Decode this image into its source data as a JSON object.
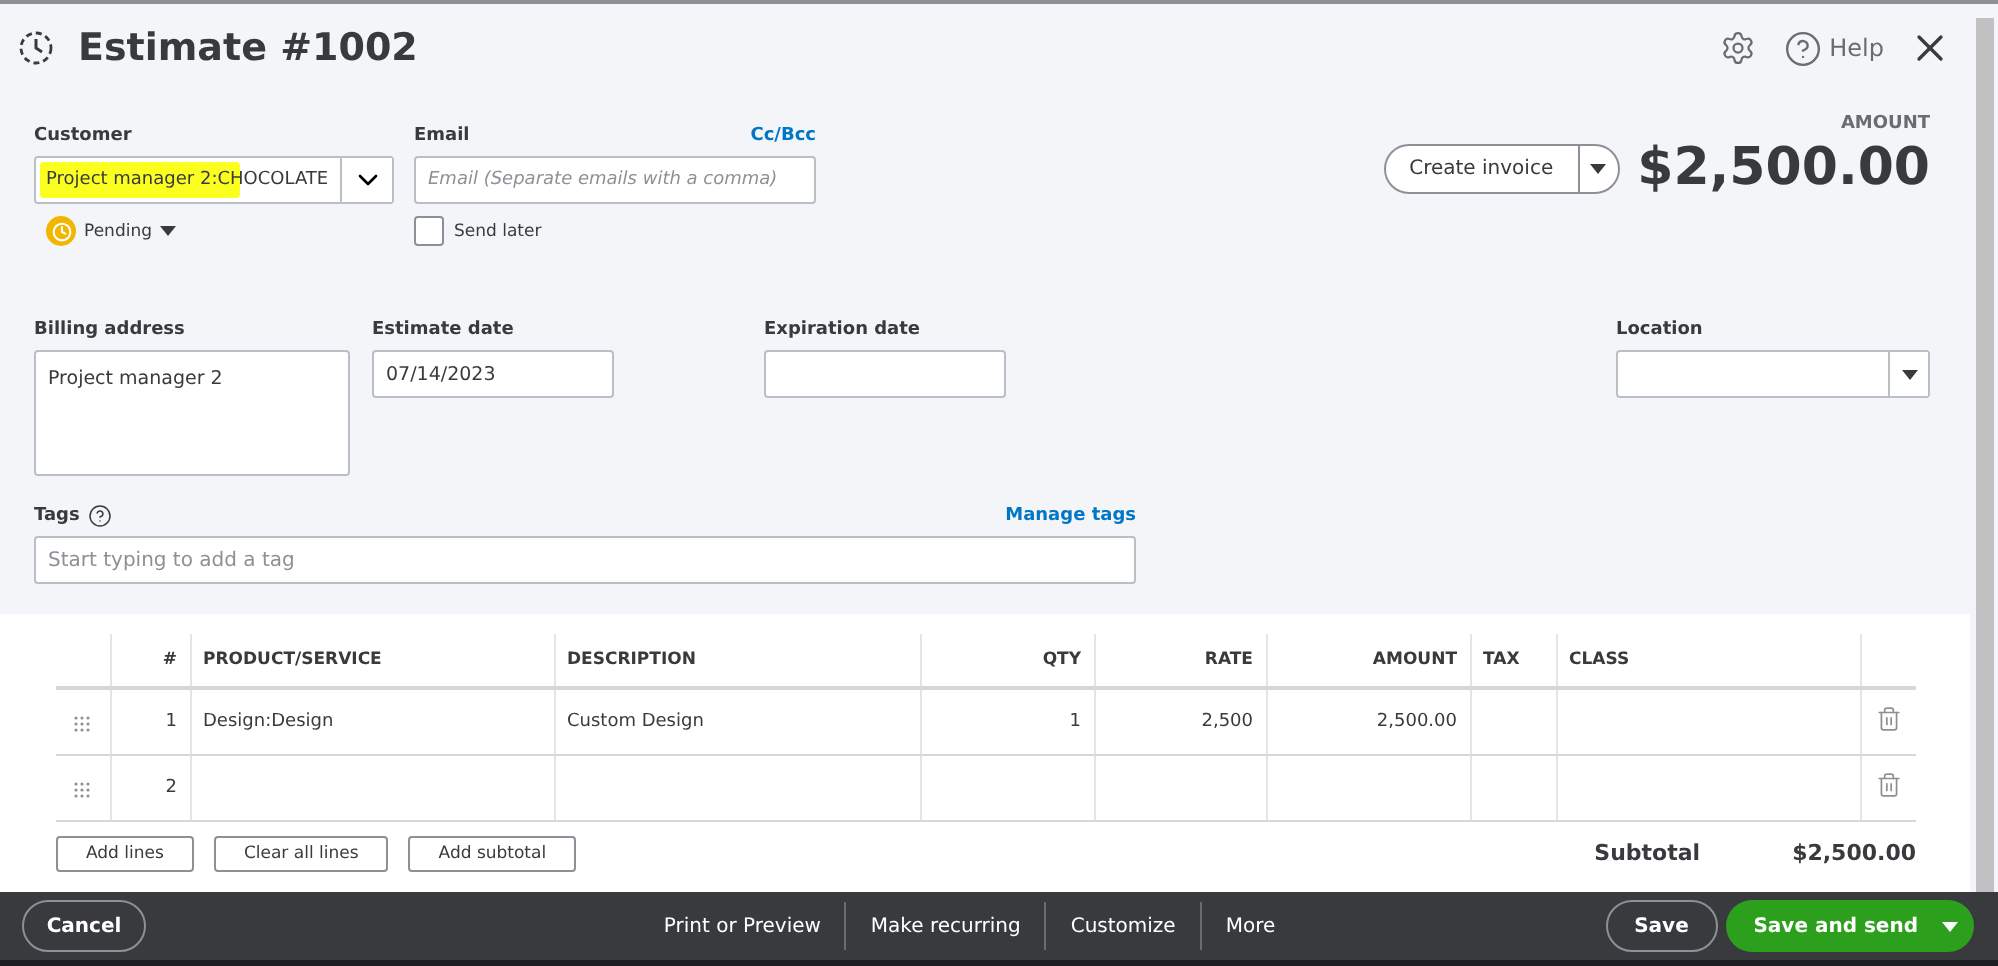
{
  "header": {
    "title": "Estimate #1002",
    "help": "Help"
  },
  "customer": {
    "label": "Customer",
    "value": "Project manager 2:CHOCOLATE",
    "highlighted": true,
    "status": "Pending"
  },
  "email": {
    "label": "Email",
    "link": "Cc/Bcc",
    "placeholder": "Email (Separate emails with a comma)",
    "send_later": {
      "label": "Send later",
      "checked": false
    }
  },
  "amount": {
    "label": "AMOUNT",
    "value": "$2,500.00",
    "action": "Create invoice"
  },
  "billing_address": {
    "label": "Billing address",
    "value": "Project manager 2"
  },
  "estimate_date": {
    "label": "Estimate date",
    "value": "07/14/2023"
  },
  "expiration_date": {
    "label": "Expiration date"
  },
  "location": {
    "label": "Location"
  },
  "tags": {
    "label": "Tags",
    "link": "Manage tags",
    "placeholder": "Start typing to add a tag"
  },
  "table": {
    "columns": [
      {
        "label": "#"
      },
      {
        "label": "PRODUCT/SERVICE"
      },
      {
        "label": "DESCRIPTION"
      },
      {
        "label": "QTY"
      },
      {
        "label": "RATE"
      },
      {
        "label": "AMOUNT"
      },
      {
        "label": "TAX"
      },
      {
        "label": "CLASS"
      }
    ],
    "rows": [
      {
        "cells": [
          "1",
          "Design:Design",
          "Custom Design",
          "1",
          "2,500",
          "2,500.00",
          "",
          ""
        ]
      },
      {
        "cells": [
          "2",
          "",
          "",
          "",
          "",
          "",
          "",
          ""
        ]
      }
    ]
  },
  "line_buttons": [
    "Add lines",
    "Clear all lines",
    "Add subtotal"
  ],
  "subtotal": {
    "label": "Subtotal",
    "value": "$2,500.00"
  },
  "footer": {
    "cancel": "Cancel",
    "links": [
      "Print or Preview",
      "Make recurring",
      "Customize",
      "More"
    ],
    "save": "Save",
    "save_and_send": "Save and send"
  }
}
